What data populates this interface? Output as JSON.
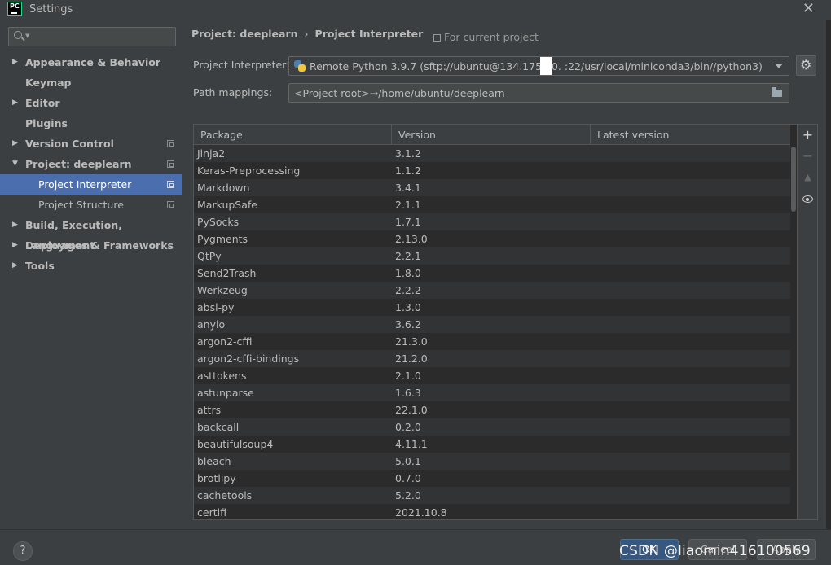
{
  "window": {
    "title": "Settings",
    "logo_text": "PC"
  },
  "sidebar": {
    "search_placeholder": "",
    "items": [
      {
        "label": "Appearance & Behavior",
        "arrow": "▶",
        "level": 0,
        "bold": true,
        "copy_icon": false,
        "selected": false
      },
      {
        "label": "Keymap",
        "arrow": "",
        "level": 0,
        "bold": true,
        "copy_icon": false,
        "selected": false
      },
      {
        "label": "Editor",
        "arrow": "▶",
        "level": 0,
        "bold": true,
        "copy_icon": false,
        "selected": false
      },
      {
        "label": "Plugins",
        "arrow": "",
        "level": 0,
        "bold": true,
        "copy_icon": false,
        "selected": false
      },
      {
        "label": "Version Control",
        "arrow": "▶",
        "level": 0,
        "bold": true,
        "copy_icon": true,
        "selected": false
      },
      {
        "label": "Project: deeplearn",
        "arrow": "▼",
        "level": 0,
        "bold": true,
        "copy_icon": true,
        "selected": false
      },
      {
        "label": "Project Interpreter",
        "arrow": "",
        "level": 1,
        "bold": false,
        "copy_icon": true,
        "selected": true
      },
      {
        "label": "Project Structure",
        "arrow": "",
        "level": 1,
        "bold": false,
        "copy_icon": true,
        "selected": false
      },
      {
        "label": "Build, Execution, Deployment",
        "arrow": "▶",
        "level": 0,
        "bold": true,
        "copy_icon": false,
        "selected": false
      },
      {
        "label": "Languages & Frameworks",
        "arrow": "▶",
        "level": 0,
        "bold": true,
        "copy_icon": false,
        "selected": false
      },
      {
        "label": "Tools",
        "arrow": "▶",
        "level": 0,
        "bold": true,
        "copy_icon": false,
        "selected": false
      }
    ]
  },
  "header": {
    "breadcrumb_project": "Project: deeplearn",
    "breadcrumb_separator": "›",
    "breadcrumb_page": "Project Interpreter",
    "scope_label": "For current project"
  },
  "interpreter": {
    "label": "Project Interpreter:",
    "value": "Remote Python 3.9.7 (sftp://ubuntu@134.175.90.     :22/usr/local/miniconda3/bin//python3)"
  },
  "path_mappings": {
    "label": "Path mappings:",
    "value": "<Project root>→/home/ubuntu/deeplearn"
  },
  "packages": {
    "columns": [
      "Package",
      "Version",
      "Latest version"
    ],
    "rows": [
      [
        "Jinja2",
        "3.1.2",
        ""
      ],
      [
        "Keras-Preprocessing",
        "1.1.2",
        ""
      ],
      [
        "Markdown",
        "3.4.1",
        ""
      ],
      [
        "MarkupSafe",
        "2.1.1",
        ""
      ],
      [
        "PySocks",
        "1.7.1",
        ""
      ],
      [
        "Pygments",
        "2.13.0",
        ""
      ],
      [
        "QtPy",
        "2.2.1",
        ""
      ],
      [
        "Send2Trash",
        "1.8.0",
        ""
      ],
      [
        "Werkzeug",
        "2.2.2",
        ""
      ],
      [
        "absl-py",
        "1.3.0",
        ""
      ],
      [
        "anyio",
        "3.6.2",
        ""
      ],
      [
        "argon2-cffi",
        "21.3.0",
        ""
      ],
      [
        "argon2-cffi-bindings",
        "21.2.0",
        ""
      ],
      [
        "asttokens",
        "2.1.0",
        ""
      ],
      [
        "astunparse",
        "1.6.3",
        ""
      ],
      [
        "attrs",
        "22.1.0",
        ""
      ],
      [
        "backcall",
        "0.2.0",
        ""
      ],
      [
        "beautifulsoup4",
        "4.11.1",
        ""
      ],
      [
        "bleach",
        "5.0.1",
        ""
      ],
      [
        "brotlipy",
        "0.7.0",
        ""
      ],
      [
        "cachetools",
        "5.2.0",
        ""
      ],
      [
        "certifi",
        "2021.10.8",
        ""
      ]
    ],
    "toolbar": {
      "add": "+",
      "remove": "−",
      "up": "▲"
    }
  },
  "footer": {
    "help": "?",
    "ok": "OK",
    "cancel": "Cancel",
    "apply": "Apply",
    "watermark": "CSDN @liaomin416100569"
  },
  "colors": {
    "background": "#3c3f41",
    "table_bg": "#2b2b2b",
    "selection": "#4b6eaf",
    "ok_button": "#365880"
  }
}
